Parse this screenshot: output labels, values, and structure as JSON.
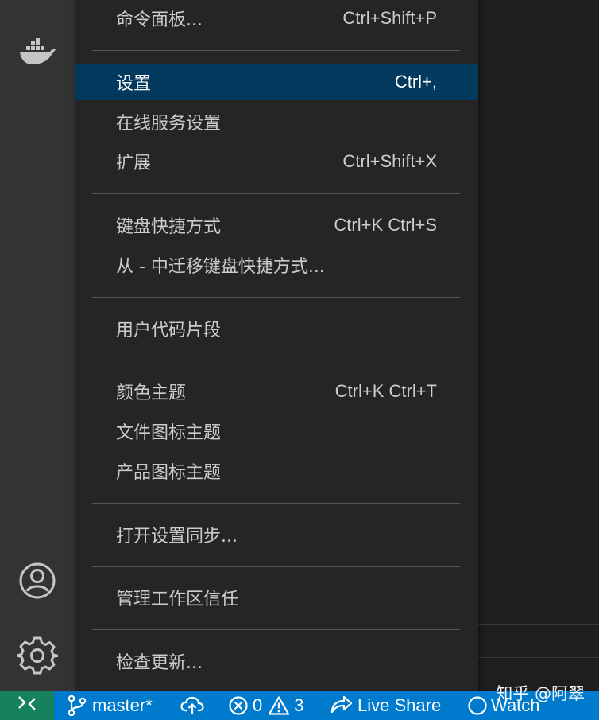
{
  "menu": {
    "items": [
      {
        "label": "命令面板...",
        "shortcut": "Ctrl+Shift+P"
      },
      {
        "label": "设置",
        "shortcut": "Ctrl+,"
      },
      {
        "label": "在线服务设置",
        "shortcut": ""
      },
      {
        "label": "扩展",
        "shortcut": "Ctrl+Shift+X"
      },
      {
        "label": "键盘快捷方式",
        "shortcut": "Ctrl+K Ctrl+S"
      },
      {
        "label": "从 - 中迁移键盘快捷方式...",
        "shortcut": ""
      },
      {
        "label": "用户代码片段",
        "shortcut": ""
      },
      {
        "label": "颜色主题",
        "shortcut": "Ctrl+K Ctrl+T"
      },
      {
        "label": "文件图标主题",
        "shortcut": ""
      },
      {
        "label": "产品图标主题",
        "shortcut": ""
      },
      {
        "label": "打开设置同步...",
        "shortcut": ""
      },
      {
        "label": "管理工作区信任",
        "shortcut": ""
      },
      {
        "label": "检查更新...",
        "shortcut": ""
      }
    ],
    "active_index": 1
  },
  "statusbar": {
    "branch": "master*",
    "errors": "0",
    "warnings": "3",
    "live_share": "Live Share",
    "watch": "Watch"
  },
  "watermark": "知乎 @阿翠",
  "colors": {
    "activity_bar": "#333333",
    "menu_bg": "#252526",
    "menu_active": "#04395e",
    "statusbar": "#007acc",
    "remote": "#16825d"
  },
  "icons": {
    "activity": [
      "docker-icon",
      "account-icon",
      "gear-icon"
    ],
    "statusbar": [
      "remote-icon",
      "git-branch-icon",
      "cloud-sync-icon",
      "error-icon",
      "warning-icon",
      "live-share-icon",
      "watch-circle-icon"
    ]
  }
}
